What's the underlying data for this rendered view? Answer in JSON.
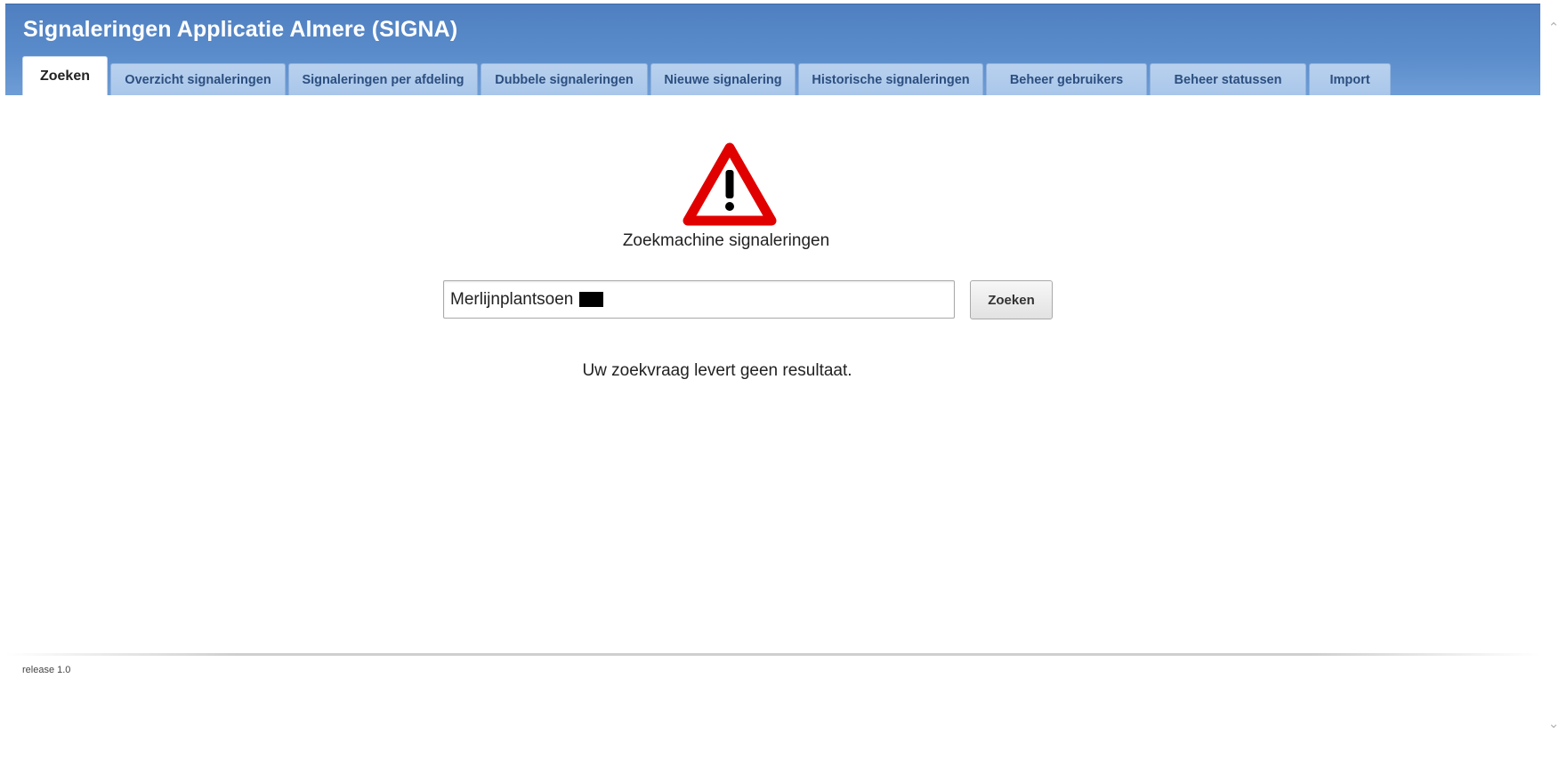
{
  "app": {
    "title": "Signaleringen Applicatie Almere (SIGNA)"
  },
  "tabs": [
    {
      "label": "Zoeken",
      "active": true
    },
    {
      "label": "Overzicht signaleringen",
      "active": false
    },
    {
      "label": "Signaleringen per afdeling",
      "active": false
    },
    {
      "label": "Dubbele signaleringen",
      "active": false
    },
    {
      "label": "Nieuwe signalering",
      "active": false
    },
    {
      "label": "Historische signaleringen",
      "active": false
    },
    {
      "label": "Beheer gebruikers",
      "active": false
    },
    {
      "label": "Beheer statussen",
      "active": false
    },
    {
      "label": "Import",
      "active": false
    }
  ],
  "main": {
    "icon": "warning-triangle-icon",
    "search_title": "Zoekmachine signaleringen",
    "search_value": "Merlijnplantsoen",
    "search_button_label": "Zoeken",
    "no_result_text": "Uw zoekvraag levert geen resultaat."
  },
  "footer": {
    "release": "release 1.0"
  },
  "scrollbar": {
    "up_icon": "chevron-up-icon",
    "down_icon": "chevron-down-icon"
  },
  "colors": {
    "header": "#5a8ccb",
    "tab": "#b0cbec",
    "warning_red": "#e10000"
  }
}
